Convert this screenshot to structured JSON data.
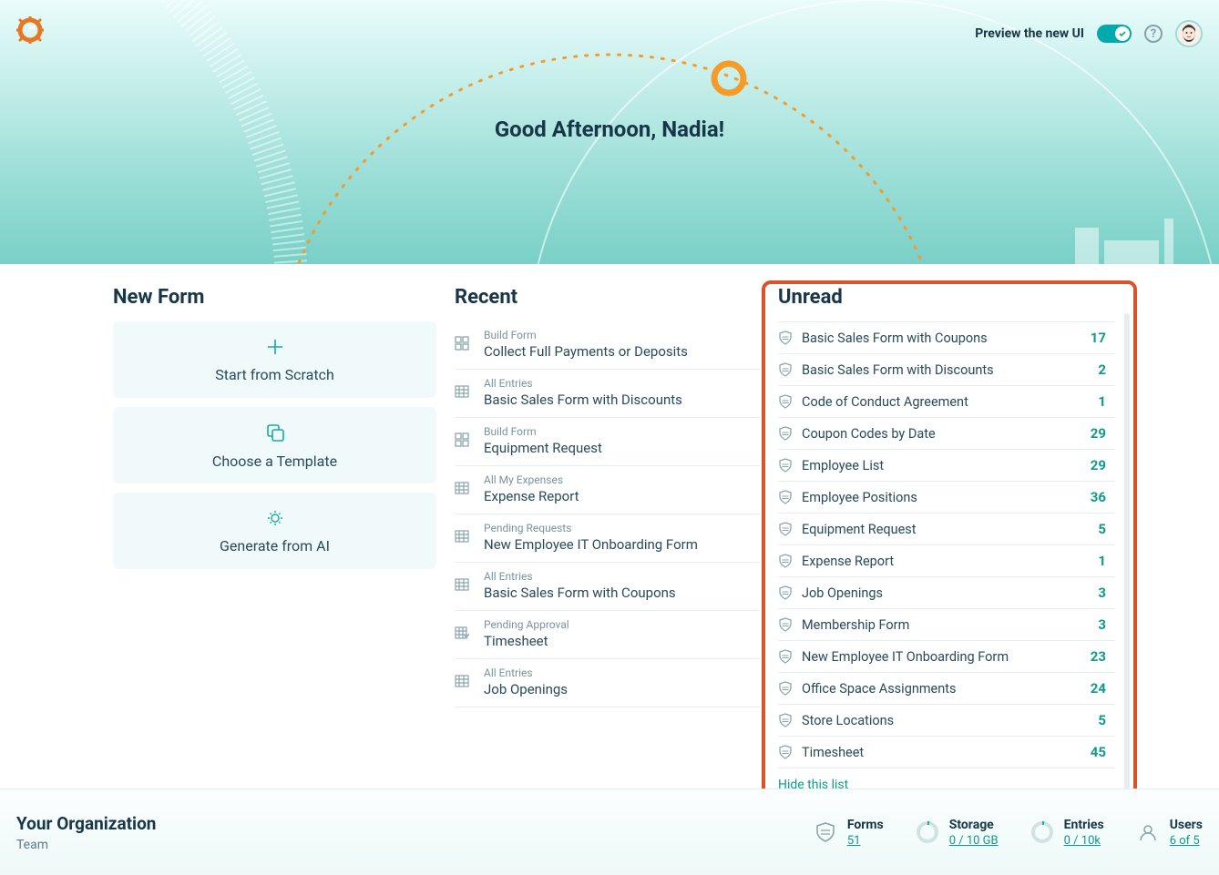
{
  "topbar": {
    "preview_label": "Preview the new UI"
  },
  "hero": {
    "greeting": "Good Afternoon, Nadia!"
  },
  "new_form": {
    "title": "New Form",
    "scratch_label": "Start from Scratch",
    "template_label": "Choose a Template",
    "ai_label": "Generate from AI"
  },
  "recent": {
    "title": "Recent",
    "items": [
      {
        "context": "Build Form",
        "name": "Collect Full Payments or Deposits",
        "icon": "layout"
      },
      {
        "context": "All Entries",
        "name": "Basic Sales Form with Discounts",
        "icon": "grid"
      },
      {
        "context": "Build Form",
        "name": "Equipment Request",
        "icon": "layout"
      },
      {
        "context": "All My Expenses",
        "name": "Expense Report",
        "icon": "grid"
      },
      {
        "context": "Pending Requests",
        "name": "New Employee IT Onboarding Form",
        "icon": "grid"
      },
      {
        "context": "All Entries",
        "name": "Basic Sales Form with Coupons",
        "icon": "grid"
      },
      {
        "context": "Pending Approval",
        "name": "Timesheet",
        "icon": "grid-check"
      },
      {
        "context": "All Entries",
        "name": "Job Openings",
        "icon": "grid"
      }
    ]
  },
  "unread": {
    "title": "Unread",
    "hide_label": "Hide this list",
    "items": [
      {
        "name": "Basic Sales Form with Coupons",
        "count": 17
      },
      {
        "name": "Basic Sales Form with Discounts",
        "count": 2
      },
      {
        "name": "Code of Conduct Agreement",
        "count": 1
      },
      {
        "name": "Coupon Codes by Date",
        "count": 29
      },
      {
        "name": "Employee List",
        "count": 29
      },
      {
        "name": "Employee Positions",
        "count": 36
      },
      {
        "name": "Equipment Request",
        "count": 5
      },
      {
        "name": "Expense Report",
        "count": 1
      },
      {
        "name": "Job Openings",
        "count": 3
      },
      {
        "name": "Membership Form",
        "count": 3
      },
      {
        "name": "New Employee IT Onboarding Form",
        "count": 23
      },
      {
        "name": "Office Space Assignments",
        "count": 24
      },
      {
        "name": "Store Locations",
        "count": 5
      },
      {
        "name": "Timesheet",
        "count": 45
      }
    ]
  },
  "footer": {
    "org_title": "Your Organization",
    "org_team": "Team",
    "stats": {
      "forms": {
        "label": "Forms",
        "value": "51"
      },
      "storage": {
        "label": "Storage",
        "value": "0 / 10 GB"
      },
      "entries": {
        "label": "Entries",
        "value": "0 / 10k"
      },
      "users": {
        "label": "Users",
        "value": "6 of 5"
      }
    }
  }
}
